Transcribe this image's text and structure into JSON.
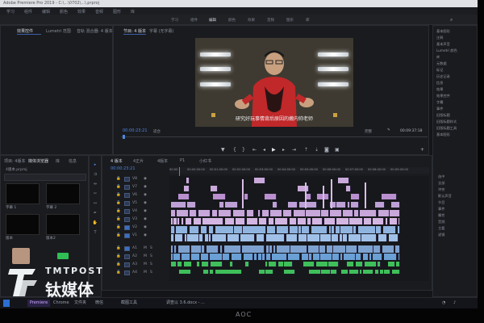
{
  "window_title": "Adobe Premiere Pro 2019 - C:\\...\\0702\\...\\.prproj",
  "menu": [
    "学习",
    "组件",
    "编辑",
    "颜色",
    "效果",
    "音频",
    "图形",
    "库"
  ],
  "workspaces": [
    "学习",
    "组件",
    "编辑",
    "颜色",
    "效果",
    "音频",
    "图形",
    "库"
  ],
  "source_panel": {
    "tabs": [
      "效果控件",
      "Lumetri 范围",
      "音轨 混合器: 4 版本"
    ],
    "active": 0
  },
  "program_panel": {
    "tabs": [
      "节目: 4 版本",
      "字幕 (无字幕)"
    ],
    "subtitle": "研究好玩事情背后原因的嫩内帅老师",
    "timecode_left": "00:00:23:21",
    "fit": "适合",
    "quality": "完整",
    "timecode_right": "00:09:37:18",
    "controls": [
      "标记",
      "入点",
      "出点",
      "转到入点",
      "后退一帧",
      "播放",
      "前进一帧",
      "转到出点",
      "提升",
      "提取",
      "导出帧",
      "比较"
    ]
  },
  "project_panel": {
    "tabs": [
      "项目: 4版本",
      "媒体浏览器",
      "库",
      "信息"
    ],
    "project_file": "4版本.prproj",
    "items": [
      {
        "name": "字幕 1",
        "thumb_caption": ""
      },
      {
        "name": "字幕 2",
        "thumb_caption": ""
      },
      {
        "name": "版本",
        "thumb_caption": ""
      },
      {
        "name": "版本2",
        "thumb_caption": ""
      }
    ]
  },
  "timeline_panel": {
    "tabs": [
      "4 版本",
      "4正片",
      "4版本",
      "P1",
      "小红书"
    ],
    "timecode": "00:00:23:21",
    "ruler_ticks": [
      "00:00",
      "00:00:00:00",
      "00:01:00:00",
      "00:02:00:00",
      "00:03:00:00",
      "00:04:00:00",
      "00:05:00:00",
      "00:06:00:00",
      "00:07:00:00",
      "00:08:00:00",
      "00:09:00:00"
    ],
    "video_tracks": [
      "V8",
      "V7",
      "V6",
      "V5",
      "V4",
      "V3",
      "V2",
      "V1"
    ],
    "audio_tracks": [
      "A1",
      "A2",
      "A3",
      "A4"
    ]
  },
  "effects_panel": {
    "items": [
      "基本图形",
      "注释",
      "基本声音",
      "Lumetri 颜色",
      "库",
      "元数据",
      "标记",
      "历史记录",
      "信息",
      "效果",
      "效果控件",
      "字幕",
      "事件",
      "旧版标题",
      "旧版标题样式",
      "旧版标题工具",
      "基本图形"
    ],
    "right_items": [
      "选中",
      "全部",
      "冲突",
      "默认声音",
      "节目",
      "事件",
      "属性",
      "音频",
      "主要",
      "滤镜"
    ]
  },
  "taskbar": {
    "items": [
      "Premiere",
      "Chrome",
      "文件夹",
      "微信",
      "截图工具"
    ],
    "doc_title": "调查以 3.6.docx - ..."
  },
  "watermark": {
    "english": "TMTPOST",
    "chinese": "钛媒体"
  },
  "monitor_brand": "AOC"
}
